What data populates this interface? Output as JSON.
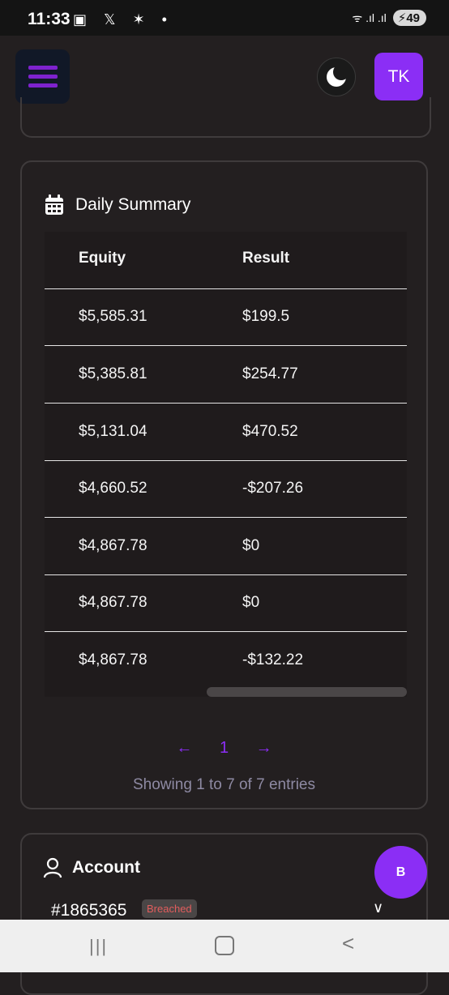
{
  "status_bar": {
    "time": "11:33",
    "left_icons": "▣ 𝕏 ✶ •",
    "signal": "ᯤ .ıl .ıl",
    "battery": "49"
  },
  "header": {
    "avatar_initials": "TK"
  },
  "daily_summary": {
    "title": "Daily Summary",
    "columns": [
      "Equity",
      "Result"
    ],
    "rows": [
      [
        "$5,585.31",
        "$199.5"
      ],
      [
        "$5,385.81",
        "$254.77"
      ],
      [
        "$5,131.04",
        "$470.52"
      ],
      [
        "$4,660.52",
        "-$207.26"
      ],
      [
        "$4,867.78",
        "$0"
      ],
      [
        "$4,867.78",
        "$0"
      ],
      [
        "$4,867.78",
        "-$132.22"
      ]
    ],
    "pagination": {
      "prev": "←",
      "page": "1",
      "next": "→"
    },
    "showing_text": "Showing 1 to 7 of 7 entries"
  },
  "account": {
    "title": "Account",
    "id": "#1865365",
    "status_badge": "Breached",
    "chevron": "∨"
  },
  "fab_label": "B",
  "nav": {
    "recents": "|||",
    "back": "<"
  }
}
